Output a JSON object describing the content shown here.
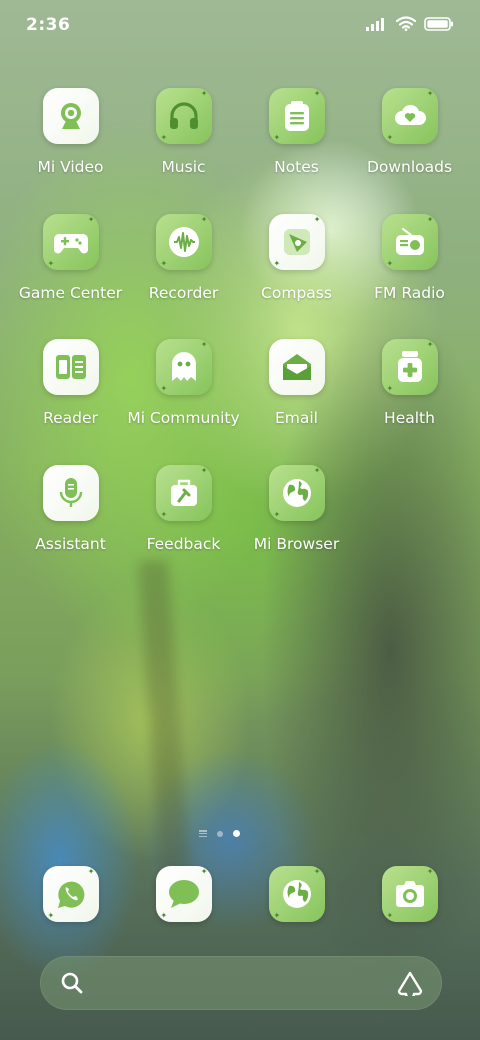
{
  "status_bar": {
    "time": "2:36",
    "icons": [
      "signal-icon",
      "wifi-icon",
      "battery-icon"
    ]
  },
  "apps": [
    {
      "label": "Mi Video",
      "icon": "webcam-icon",
      "tile": "white"
    },
    {
      "label": "Music",
      "icon": "headphones-icon",
      "tile": "green"
    },
    {
      "label": "Notes",
      "icon": "notepad-icon",
      "tile": "green"
    },
    {
      "label": "Downloads",
      "icon": "cloud-download-icon",
      "tile": "green"
    },
    {
      "label": "Game Center",
      "icon": "gamepad-icon",
      "tile": "green"
    },
    {
      "label": "Recorder",
      "icon": "waveform-icon",
      "tile": "green"
    },
    {
      "label": "Compass",
      "icon": "compass-icon",
      "tile": "white"
    },
    {
      "label": "FM Radio",
      "icon": "radio-icon",
      "tile": "green"
    },
    {
      "label": "Reader",
      "icon": "book-icon",
      "tile": "white"
    },
    {
      "label": "Mi Community",
      "icon": "ghost-icon",
      "tile": "green"
    },
    {
      "label": "Email",
      "icon": "envelope-icon",
      "tile": "white"
    },
    {
      "label": "Health",
      "icon": "medicine-jar-icon",
      "tile": "green"
    },
    {
      "label": "Assistant",
      "icon": "microphone-icon",
      "tile": "white"
    },
    {
      "label": "Feedback",
      "icon": "toolbox-icon",
      "tile": "green"
    },
    {
      "label": "Mi Browser",
      "icon": "globe-icon",
      "tile": "green"
    }
  ],
  "page_indicator": {
    "pages": 2,
    "current": 2
  },
  "dock": [
    {
      "icon": "phone-icon",
      "tile": "white"
    },
    {
      "icon": "message-bubble-icon",
      "tile": "white"
    },
    {
      "icon": "globe-icon",
      "tile": "green"
    },
    {
      "icon": "camera-icon",
      "tile": "green"
    }
  ],
  "search": {
    "placeholder": ""
  },
  "colors": {
    "accent_green": "#86c45c",
    "icon_green": "#5fa83a",
    "tile_white": "#ffffff"
  }
}
